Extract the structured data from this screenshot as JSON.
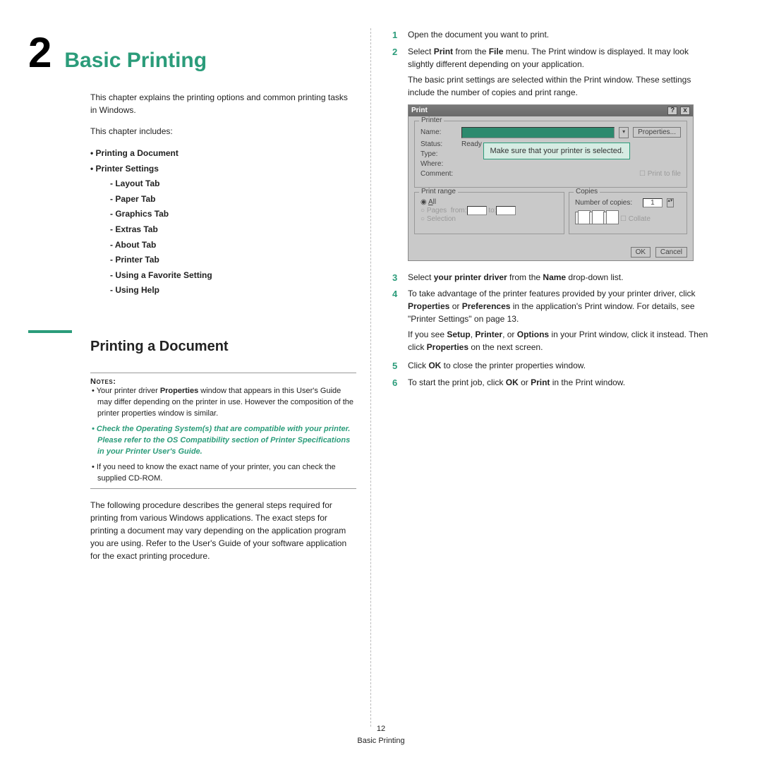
{
  "chapter": {
    "number": "2",
    "title": "Basic Printing"
  },
  "intro": "This chapter explains the printing options and common printing tasks in Windows.",
  "includes_label": "This chapter includes:",
  "toc": {
    "i0": "Printing a Document",
    "i1": "Printer Settings",
    "s0": "Layout Tab",
    "s1": "Paper Tab",
    "s2": "Graphics Tab",
    "s3": "Extras Tab",
    "s4": "About Tab",
    "s5": "Printer Tab",
    "s6": "Using a Favorite Setting",
    "s7": "Using Help"
  },
  "section_title": "Printing a Document",
  "notes_label": "Notes",
  "notes": {
    "n1a": "Your printer driver ",
    "n1b": "Properties",
    "n1c": " window that appears in this User's Guide may differ depending on the printer in use. However the composition of the printer properties window is similar.",
    "n2": "Check the Operating System(s) that are compatible with your printer. Please refer to the OS Compatibility section of Printer Specifications in your Printer User's Guide.",
    "n3": "If you need to know the exact name of your printer, you can check the supplied CD-ROM."
  },
  "following": "The following procedure describes the general steps required for printing from various Windows applications. The exact steps for printing a document may vary depending on the application program you are using. Refer to the User's Guide of your software application for the exact printing procedure.",
  "steps": {
    "s1": "Open the document you want to print.",
    "s2a": "Select ",
    "s2b": "Print",
    "s2c": " from the ",
    "s2d": "File",
    "s2e": " menu. The Print window is displayed. It may look slightly different depending on your application.",
    "s2sub": "The basic print settings are selected within the Print window. These settings include the number of copies and print range.",
    "s3a": "Select ",
    "s3b": "your printer driver",
    "s3c": " from the ",
    "s3d": "Name",
    "s3e": " drop-down list.",
    "s4a": "To take advantage of the printer features provided by your printer driver, click ",
    "s4b": "Properties",
    "s4c": " or ",
    "s4d": "Preferences",
    "s4e": " in the application's Print window. For details, see \"Printer Settings\" on page 13.",
    "s4suba": "If you see ",
    "s4subb": "Setup",
    "s4subc": ", ",
    "s4subd": "Printer",
    "s4sube": ", or ",
    "s4subf": "Options",
    "s4subg": " in your Print window, click it instead. Then click ",
    "s4subh": "Properties",
    "s4subi": " on the next screen.",
    "s5a": "Click ",
    "s5b": "OK",
    "s5c": " to close the printer properties window.",
    "s6a": "To start the print job, click ",
    "s6b": "OK",
    "s6c": " or ",
    "s6d": "Print",
    "s6e": " in the Print window."
  },
  "dialog": {
    "title": "Print",
    "printer_group": "Printer",
    "name": "Name:",
    "properties": "Properties...",
    "status": "Status:",
    "status_val": "Ready",
    "type": "Type:",
    "where": "Where:",
    "comment": "Comment:",
    "print_to_file": "Print to file",
    "range_group": "Print range",
    "all": "All",
    "pages": "Pages",
    "from": "from:",
    "to": "to:",
    "selection": "Selection",
    "copies_group": "Copies",
    "num_copies": "Number of copies:",
    "copies_val": "1",
    "collate": "Collate",
    "ok": "OK",
    "cancel": "Cancel",
    "callout": "Make sure that your printer is selected."
  },
  "footer": {
    "page": "12",
    "title": "Basic Printing"
  }
}
